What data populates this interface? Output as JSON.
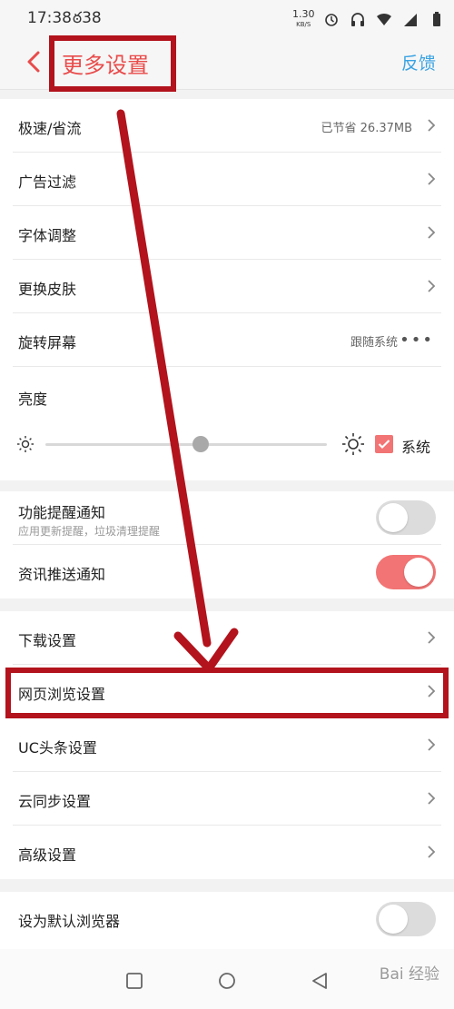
{
  "status_bar": {
    "time": "17:38",
    "carrier": "ఠ38",
    "speed_value": "1.30",
    "speed_unit": "KB/S"
  },
  "header": {
    "title": "更多设置",
    "feedback": "反馈"
  },
  "section1": {
    "speed_saver": {
      "label": "极速/省流",
      "value": "已节省 26.37MB"
    },
    "ad_filter": {
      "label": "广告过滤"
    },
    "font_adjust": {
      "label": "字体调整"
    },
    "change_skin": {
      "label": "更换皮肤"
    },
    "rotate_screen": {
      "label": "旋转屏幕",
      "value": "跟随系统"
    },
    "brightness": {
      "label": "亮度",
      "level_fraction": 0.55,
      "system_label": "系统",
      "system_checked": true
    }
  },
  "section2": {
    "feature_notice": {
      "label": "功能提醒通知",
      "sub": "应用更新提醒，垃圾清理提醒",
      "enabled": false
    },
    "news_push": {
      "label": "资讯推送通知",
      "enabled": true
    }
  },
  "section3": {
    "download": {
      "label": "下载设置"
    },
    "web_browsing": {
      "label": "网页浏览设置"
    },
    "uc_headlines": {
      "label": "UC头条设置"
    },
    "cloud_sync": {
      "label": "云同步设置"
    },
    "advanced": {
      "label": "高级设置"
    }
  },
  "section4": {
    "default_browser": {
      "label": "设为默认浏览器",
      "enabled": false
    }
  },
  "watermark": "Bai 经验",
  "colors": {
    "accent": "#f27474",
    "title_red": "#e94b4b",
    "link_blue": "#3aa3e3",
    "annotation_red": "#b2131c"
  },
  "icons": [
    "back-chevron-icon",
    "chevron-right-icon",
    "more-dots-icon",
    "sun-low-icon",
    "sun-high-icon",
    "check-icon",
    "nav-recent-icon",
    "nav-home-icon",
    "nav-back-icon"
  ]
}
